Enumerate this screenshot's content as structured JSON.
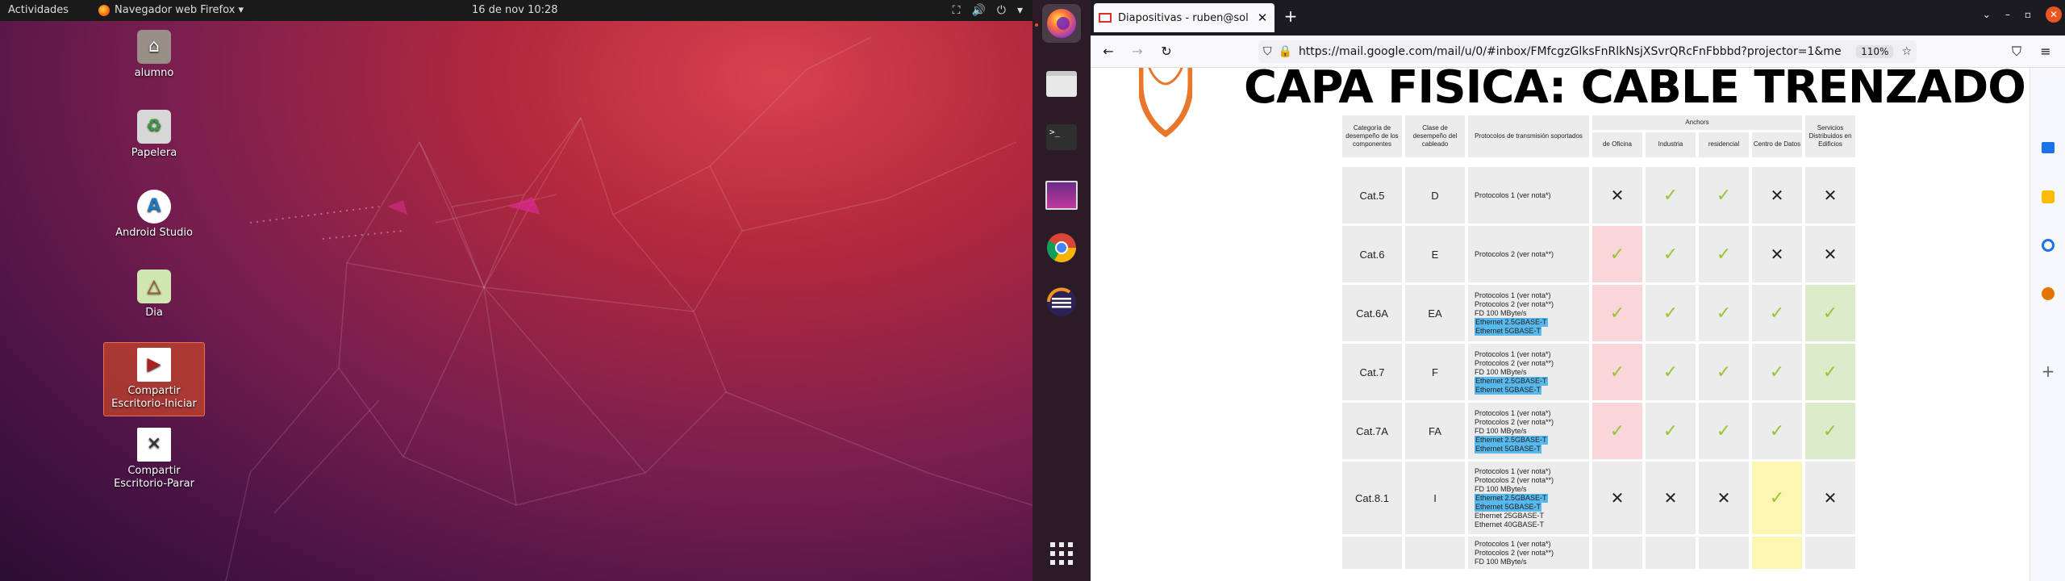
{
  "topbar": {
    "activities": "Actividades",
    "app_menu": "Navegador web Firefox ▾",
    "clock": "16 de nov  10:28",
    "tray": [
      "⛶",
      "🔊",
      "⏻",
      "▾"
    ]
  },
  "desktop": {
    "icons": [
      {
        "label": "alumno",
        "icon": "home-folder-icon"
      },
      {
        "label": "Papelera",
        "icon": "trash-icon"
      },
      {
        "label": "Android Studio",
        "icon": "android-studio-icon"
      },
      {
        "label": "Dia",
        "icon": "dia-icon"
      },
      {
        "label": "Compartir Escritorio-Iniciar",
        "icon": "share-desktop-start-icon"
      },
      {
        "label": "Compartir Escritorio-Parar",
        "icon": "share-desktop-stop-icon"
      }
    ]
  },
  "dock": {
    "items": [
      "firefox-icon",
      "files-icon",
      "terminal-icon",
      "screen-share-icon",
      "chrome-icon",
      "eclipse-icon",
      "app-grid-icon"
    ]
  },
  "browser": {
    "tab_title": "Diapositivas - ruben@sol",
    "url": "https://mail.google.com/mail/u/0/#inbox/FMfcgzGlksFnRlkNsjXSvrQRcFnFbbbd?projector=1&me",
    "zoom": "110%"
  },
  "slide": {
    "title": "CAPA FISICA: CABLE TRENZADO",
    "headers": {
      "categoria": "Categoría de desempeño de los componentes",
      "clase": "Clase de desempeño del cableado",
      "protocolos": "Protocolos de transmisión soportados",
      "anchors": "Anchors",
      "oficina": "de Oficina",
      "industria": "Industria",
      "residencial": "residencial",
      "centro": "Centro de Datos",
      "servicios": "Servicios Distribuidos en Edificios"
    },
    "rows": [
      {
        "cat": "Cat.5",
        "cls": "D",
        "prot": [
          "Protocolos 1 (ver nota*)"
        ],
        "hl": [],
        "marks": [
          "no",
          "ok",
          "ok",
          "no",
          "no"
        ]
      },
      {
        "cat": "Cat.6",
        "cls": "E",
        "prot": [
          "Protocolos 2 (ver nota**)"
        ],
        "hl": [],
        "marks": [
          "ok",
          "ok",
          "ok",
          "no",
          "no"
        ]
      },
      {
        "cat": "Cat.6A",
        "cls": "EA",
        "prot": [
          "Protocolos 1 (ver nota*)",
          "Protocolos 2 (ver nota**)",
          "FD 100 MByte/s"
        ],
        "hl": [
          "Ethernet 2.5GBASE-T",
          "Ethernet 5GBASE-T"
        ],
        "marks": [
          "ok",
          "ok",
          "ok",
          "ok",
          "ok"
        ]
      },
      {
        "cat": "Cat.7",
        "cls": "F",
        "prot": [
          "Protocolos 1 (ver nota*)",
          "Protocolos 2 (ver nota**)",
          "FD 100 MByte/s"
        ],
        "hl": [
          "Ethernet 2.5GBASE-T",
          "Ethernet 5GBASE-T"
        ],
        "marks": [
          "ok",
          "ok",
          "ok",
          "ok",
          "ok"
        ]
      },
      {
        "cat": "Cat.7A",
        "cls": "FA",
        "prot": [
          "Protocolos 1 (ver nota*)",
          "Protocolos 2 (ver nota**)",
          "FD 100 MByte/s"
        ],
        "hl": [
          "Ethernet 2.5GBASE-T",
          "Ethernet 5GBASE-T"
        ],
        "marks": [
          "ok",
          "ok",
          "ok",
          "ok",
          "ok"
        ]
      },
      {
        "cat": "Cat.8.1",
        "cls": "I",
        "prot": [
          "Protocolos 1 (ver nota*)",
          "Protocolos 2 (ver nota**)",
          "FD 100 MByte/s"
        ],
        "hl": [
          "Ethernet 2.5GBASE-T",
          "Ethernet 5GBASE-T"
        ],
        "extra": [
          "Ethernet 25GBASE-T",
          "Ethernet 40GBASE-T"
        ],
        "marks": [
          "no",
          "no",
          "no",
          "ok",
          "no"
        ]
      },
      {
        "cat": "",
        "cls": "",
        "prot": [
          "Protocolos 1 (ver nota*)",
          "Protocolos 2 (ver nota**)",
          "FD 100 MByte/s"
        ],
        "hl": [],
        "marks": [
          "",
          "",
          "",
          "",
          ""
        ]
      }
    ]
  },
  "colors": {
    "ubuntu_orange": "#e95420",
    "check_green": "#9bc434",
    "highlight_blue": "#58b8ec"
  }
}
